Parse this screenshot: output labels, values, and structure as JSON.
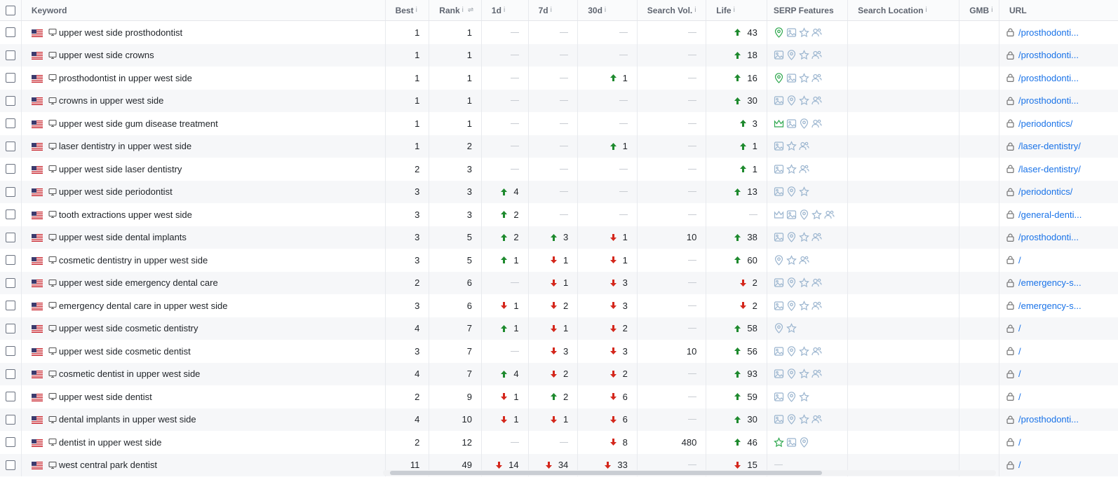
{
  "columns": {
    "keyword": "Keyword",
    "best": "Best",
    "rank": "Rank",
    "d1": "1d",
    "d7": "7d",
    "d30": "30d",
    "search_vol": "Search Vol.",
    "life": "Life",
    "serp_features": "SERP Features",
    "search_location": "Search Location",
    "gmb": "GMB",
    "url": "URL",
    "info_glyph": "i",
    "sort_glyph": "⇌"
  },
  "colors": {
    "up": "#1e8a2e",
    "down": "#d4271c",
    "link": "#1a73e8",
    "serp_highlight": "#2fa84f",
    "serp_default": "#9bb5cf"
  },
  "rows": [
    {
      "keyword": "upper west side prosthodontist",
      "best": "1",
      "rank": "1",
      "d1": {
        "dir": "none",
        "val": ""
      },
      "d7": {
        "dir": "none",
        "val": ""
      },
      "d30": {
        "dir": "none",
        "val": ""
      },
      "sv": "—",
      "life": {
        "dir": "up",
        "val": "43"
      },
      "serp": [
        "map-pin-green",
        "image",
        "star",
        "people"
      ],
      "url": "/prosthodonti..."
    },
    {
      "keyword": "upper west side crowns",
      "best": "1",
      "rank": "1",
      "d1": {
        "dir": "none",
        "val": ""
      },
      "d7": {
        "dir": "none",
        "val": ""
      },
      "d30": {
        "dir": "none",
        "val": ""
      },
      "sv": "—",
      "life": {
        "dir": "up",
        "val": "18"
      },
      "serp": [
        "image",
        "map-pin",
        "star",
        "people"
      ],
      "url": "/prosthodonti..."
    },
    {
      "keyword": "prosthodontist in upper west side",
      "best": "1",
      "rank": "1",
      "d1": {
        "dir": "none",
        "val": ""
      },
      "d7": {
        "dir": "none",
        "val": ""
      },
      "d30": {
        "dir": "up",
        "val": "1"
      },
      "sv": "—",
      "life": {
        "dir": "up",
        "val": "16"
      },
      "serp": [
        "map-pin-green",
        "image",
        "star",
        "people"
      ],
      "url": "/prosthodonti..."
    },
    {
      "keyword": "crowns in upper west side",
      "best": "1",
      "rank": "1",
      "d1": {
        "dir": "none",
        "val": ""
      },
      "d7": {
        "dir": "none",
        "val": ""
      },
      "d30": {
        "dir": "none",
        "val": ""
      },
      "sv": "—",
      "life": {
        "dir": "up",
        "val": "30"
      },
      "serp": [
        "image",
        "map-pin",
        "star",
        "people"
      ],
      "url": "/prosthodonti..."
    },
    {
      "keyword": "upper west side gum disease treatment",
      "best": "1",
      "rank": "1",
      "d1": {
        "dir": "none",
        "val": ""
      },
      "d7": {
        "dir": "none",
        "val": ""
      },
      "d30": {
        "dir": "none",
        "val": ""
      },
      "sv": "—",
      "life": {
        "dir": "up",
        "val": "3"
      },
      "serp": [
        "crown-green",
        "image",
        "map-pin",
        "people"
      ],
      "url": "/periodontics/"
    },
    {
      "keyword": "laser dentistry in upper west side",
      "best": "1",
      "rank": "2",
      "d1": {
        "dir": "none",
        "val": ""
      },
      "d7": {
        "dir": "none",
        "val": ""
      },
      "d30": {
        "dir": "up",
        "val": "1"
      },
      "sv": "—",
      "life": {
        "dir": "up",
        "val": "1"
      },
      "serp": [
        "image",
        "star",
        "people"
      ],
      "url": "/laser-dentistry/"
    },
    {
      "keyword": "upper west side laser dentistry",
      "best": "2",
      "rank": "3",
      "d1": {
        "dir": "none",
        "val": ""
      },
      "d7": {
        "dir": "none",
        "val": ""
      },
      "d30": {
        "dir": "none",
        "val": ""
      },
      "sv": "—",
      "life": {
        "dir": "up",
        "val": "1"
      },
      "serp": [
        "image",
        "star",
        "people"
      ],
      "url": "/laser-dentistry/"
    },
    {
      "keyword": "upper west side periodontist",
      "best": "3",
      "rank": "3",
      "d1": {
        "dir": "up",
        "val": "4"
      },
      "d7": {
        "dir": "none",
        "val": ""
      },
      "d30": {
        "dir": "none",
        "val": ""
      },
      "sv": "—",
      "life": {
        "dir": "up",
        "val": "13"
      },
      "serp": [
        "image",
        "map-pin",
        "star"
      ],
      "url": "/periodontics/"
    },
    {
      "keyword": "tooth extractions upper west side",
      "best": "3",
      "rank": "3",
      "d1": {
        "dir": "up",
        "val": "2"
      },
      "d7": {
        "dir": "none",
        "val": ""
      },
      "d30": {
        "dir": "none",
        "val": ""
      },
      "sv": "—",
      "life": {
        "dir": "none",
        "val": ""
      },
      "serp": [
        "crown",
        "image",
        "map-pin",
        "star",
        "people"
      ],
      "url": "/general-denti..."
    },
    {
      "keyword": "upper west side dental implants",
      "best": "3",
      "rank": "5",
      "d1": {
        "dir": "up",
        "val": "2"
      },
      "d7": {
        "dir": "up",
        "val": "3"
      },
      "d30": {
        "dir": "down",
        "val": "1"
      },
      "sv": "10",
      "life": {
        "dir": "up",
        "val": "38"
      },
      "serp": [
        "image",
        "map-pin",
        "star",
        "people"
      ],
      "url": "/prosthodonti..."
    },
    {
      "keyword": "cosmetic dentistry in upper west side",
      "best": "3",
      "rank": "5",
      "d1": {
        "dir": "up",
        "val": "1"
      },
      "d7": {
        "dir": "down",
        "val": "1"
      },
      "d30": {
        "dir": "down",
        "val": "1"
      },
      "sv": "—",
      "life": {
        "dir": "up",
        "val": "60"
      },
      "serp": [
        "map-pin",
        "star",
        "people"
      ],
      "url": "/"
    },
    {
      "keyword": "upper west side emergency dental care",
      "best": "2",
      "rank": "6",
      "d1": {
        "dir": "none",
        "val": ""
      },
      "d7": {
        "dir": "down",
        "val": "1"
      },
      "d30": {
        "dir": "down",
        "val": "3"
      },
      "sv": "—",
      "life": {
        "dir": "down",
        "val": "2"
      },
      "serp": [
        "image",
        "map-pin",
        "star",
        "people"
      ],
      "url": "/emergency-s..."
    },
    {
      "keyword": "emergency dental care in upper west side",
      "best": "3",
      "rank": "6",
      "d1": {
        "dir": "down",
        "val": "1"
      },
      "d7": {
        "dir": "down",
        "val": "2"
      },
      "d30": {
        "dir": "down",
        "val": "3"
      },
      "sv": "—",
      "life": {
        "dir": "down",
        "val": "2"
      },
      "serp": [
        "image",
        "map-pin",
        "star",
        "people"
      ],
      "url": "/emergency-s..."
    },
    {
      "keyword": "upper west side cosmetic dentistry",
      "best": "4",
      "rank": "7",
      "d1": {
        "dir": "up",
        "val": "1"
      },
      "d7": {
        "dir": "down",
        "val": "1"
      },
      "d30": {
        "dir": "down",
        "val": "2"
      },
      "sv": "—",
      "life": {
        "dir": "up",
        "val": "58"
      },
      "serp": [
        "map-pin",
        "star"
      ],
      "url": "/"
    },
    {
      "keyword": "upper west side cosmetic dentist",
      "best": "3",
      "rank": "7",
      "d1": {
        "dir": "none",
        "val": ""
      },
      "d7": {
        "dir": "down",
        "val": "3"
      },
      "d30": {
        "dir": "down",
        "val": "3"
      },
      "sv": "10",
      "life": {
        "dir": "up",
        "val": "56"
      },
      "serp": [
        "image",
        "map-pin",
        "star",
        "people"
      ],
      "url": "/"
    },
    {
      "keyword": "cosmetic dentist in upper west side",
      "best": "4",
      "rank": "7",
      "d1": {
        "dir": "up",
        "val": "4"
      },
      "d7": {
        "dir": "down",
        "val": "2"
      },
      "d30": {
        "dir": "down",
        "val": "2"
      },
      "sv": "—",
      "life": {
        "dir": "up",
        "val": "93"
      },
      "serp": [
        "image",
        "map-pin",
        "star",
        "people"
      ],
      "url": "/"
    },
    {
      "keyword": "upper west side dentist",
      "best": "2",
      "rank": "9",
      "d1": {
        "dir": "down",
        "val": "1"
      },
      "d7": {
        "dir": "up",
        "val": "2"
      },
      "d30": {
        "dir": "down",
        "val": "6"
      },
      "sv": "—",
      "life": {
        "dir": "up",
        "val": "59"
      },
      "serp": [
        "image",
        "map-pin",
        "star"
      ],
      "url": "/"
    },
    {
      "keyword": "dental implants in upper west side",
      "best": "4",
      "rank": "10",
      "d1": {
        "dir": "down",
        "val": "1"
      },
      "d7": {
        "dir": "down",
        "val": "1"
      },
      "d30": {
        "dir": "down",
        "val": "6"
      },
      "sv": "—",
      "life": {
        "dir": "up",
        "val": "30"
      },
      "serp": [
        "image",
        "map-pin",
        "star",
        "people"
      ],
      "url": "/prosthodonti..."
    },
    {
      "keyword": "dentist in upper west side",
      "best": "2",
      "rank": "12",
      "d1": {
        "dir": "none",
        "val": ""
      },
      "d7": {
        "dir": "none",
        "val": ""
      },
      "d30": {
        "dir": "down",
        "val": "8"
      },
      "sv": "480",
      "life": {
        "dir": "up",
        "val": "46"
      },
      "serp": [
        "star-green",
        "image",
        "map-pin"
      ],
      "url": "/"
    },
    {
      "keyword": "west central park dentist",
      "best": "11",
      "rank": "49",
      "d1": {
        "dir": "down",
        "val": "14"
      },
      "d7": {
        "dir": "down",
        "val": "34"
      },
      "d30": {
        "dir": "down",
        "val": "33"
      },
      "sv": "—",
      "life": {
        "dir": "down",
        "val": "15"
      },
      "serp": [
        "dash"
      ],
      "url": "/"
    }
  ]
}
